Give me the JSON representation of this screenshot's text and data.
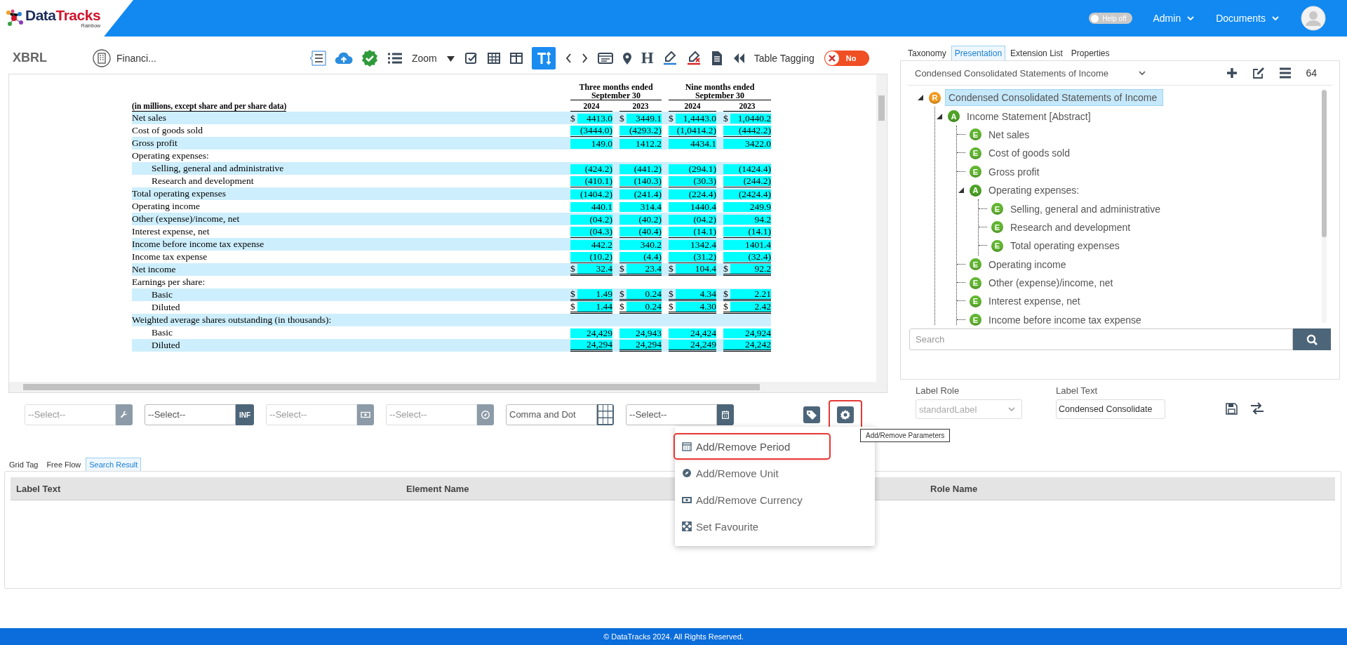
{
  "header": {
    "logo_primary": "Data",
    "logo_secondary": "Tracks",
    "logo_subtitle": "Rainbow",
    "help_toggle": {
      "label": "Help off",
      "on": false
    },
    "menus": [
      "Admin",
      "Documents"
    ]
  },
  "toolbar": {
    "title": "XBRL",
    "document": "Financi...",
    "tools": [
      {
        "kind": "icon",
        "selected": false
      },
      {
        "kind": "icon",
        "selected": false
      },
      {
        "kind": "icon",
        "selected": false
      },
      {
        "kind": "icon",
        "selected": false
      },
      {
        "kind": "label",
        "text": "Zoom"
      },
      {
        "kind": "icon",
        "selected": false
      },
      {
        "kind": "icon",
        "selected": false
      },
      {
        "kind": "icon",
        "selected": false
      },
      {
        "kind": "icon",
        "selected": false
      },
      {
        "kind": "icon",
        "selected": true
      },
      {
        "kind": "icon",
        "selected": false
      },
      {
        "kind": "icon",
        "selected": false
      },
      {
        "kind": "icon",
        "selected": false
      },
      {
        "kind": "icon",
        "selected": false
      },
      {
        "kind": "glyph",
        "text": "H"
      },
      {
        "kind": "icon",
        "selected": false
      },
      {
        "kind": "icon",
        "selected": false
      },
      {
        "kind": "icon",
        "selected": false
      },
      {
        "kind": "icon",
        "selected": false
      },
      {
        "kind": "label",
        "text": "Table Tagging"
      }
    ],
    "toggle": {
      "label": "No",
      "on": false
    }
  },
  "statement": {
    "caption": "(in millions, except share and per share data)",
    "groups": [
      "Three months ended September 30",
      "Nine months ended September 30"
    ],
    "years": [
      "2024",
      "2023",
      "2024",
      "2023"
    ],
    "rows": [
      {
        "label": "Net sales",
        "kind": "line",
        "shaded": true,
        "cells": [
          {
            "symbol": "$",
            "value": "4413.0"
          },
          {
            "symbol": "$",
            "value": "3449.1"
          },
          {
            "symbol": "$",
            "value": "1,4443.0"
          },
          {
            "symbol": "$",
            "value": "1,0440.2"
          }
        ]
      },
      {
        "label": "Cost of goods sold",
        "kind": "line",
        "shaded": false,
        "underlined": true,
        "cells": [
          {
            "value": "(3444.0)"
          },
          {
            "value": "(4293.2)"
          },
          {
            "value": "(1,0414.2)"
          },
          {
            "value": "(4442.2)"
          }
        ]
      },
      {
        "label": "Gross profit",
        "kind": "line",
        "shaded": true,
        "cells": [
          {
            "value": "149.0"
          },
          {
            "value": "1412.2"
          },
          {
            "value": "4434.1"
          },
          {
            "value": "3422.0"
          }
        ]
      },
      {
        "label": "Operating expenses:",
        "kind": "line",
        "shaded": false
      },
      {
        "label": "Selling, general and administrative",
        "kind": "sub",
        "shaded": true,
        "cells": [
          {
            "value": "(424.2)"
          },
          {
            "value": "(441.2)"
          },
          {
            "value": "(294.1)"
          },
          {
            "value": "(1424.4)"
          }
        ]
      },
      {
        "label": "Research and development",
        "kind": "sub",
        "shaded": false,
        "underlined": true,
        "cells": [
          {
            "value": "(410.1)"
          },
          {
            "value": "(140.3)"
          },
          {
            "value": "(30.3)"
          },
          {
            "value": "(244.2)"
          }
        ]
      },
      {
        "label": "Total operating expenses",
        "kind": "line",
        "shaded": true,
        "cells": [
          {
            "value": "(1404.2)"
          },
          {
            "value": "(241.4)"
          },
          {
            "value": "(224.4)"
          },
          {
            "value": "(2424.4)"
          }
        ]
      },
      {
        "label": "Operating income",
        "kind": "line",
        "shaded": false,
        "cells": [
          {
            "value": "440.1"
          },
          {
            "value": "314.4"
          },
          {
            "value": "1440.4"
          },
          {
            "value": "249.9"
          }
        ]
      },
      {
        "label": "Other (expense)/income, net",
        "kind": "line",
        "shaded": true,
        "cells": [
          {
            "value": "(04.2)"
          },
          {
            "value": "(40.2)"
          },
          {
            "value": "(04.2)"
          },
          {
            "value": "94.2"
          }
        ]
      },
      {
        "label": "Interest expense, net",
        "kind": "line",
        "shaded": false,
        "underlined": true,
        "cells": [
          {
            "value": "(04.3)"
          },
          {
            "value": "(40.4)"
          },
          {
            "value": "(14.1)"
          },
          {
            "value": "(14.1)"
          }
        ]
      },
      {
        "label": "Income before income tax expense",
        "kind": "line",
        "shaded": true,
        "cells": [
          {
            "value": "442.2"
          },
          {
            "value": "340.2"
          },
          {
            "value": "1342.4"
          },
          {
            "value": "1401.4"
          }
        ]
      },
      {
        "label": "Income tax expense",
        "kind": "line",
        "shaded": false,
        "underlined": true,
        "cells": [
          {
            "value": "(10.2)"
          },
          {
            "value": "(4.4)"
          },
          {
            "value": "(31.2)"
          },
          {
            "value": "(32.4)"
          }
        ]
      },
      {
        "label": "Net income",
        "kind": "line",
        "shaded": true,
        "double_underlined": true,
        "cells": [
          {
            "symbol": "$",
            "value": "32.4"
          },
          {
            "symbol": "$",
            "value": "23.4"
          },
          {
            "symbol": "$",
            "value": "104.4"
          },
          {
            "symbol": "$",
            "value": "92.2"
          }
        ]
      },
      {
        "label": "Earnings per share:",
        "kind": "line",
        "shaded": false
      },
      {
        "label": "Basic",
        "kind": "sub",
        "shaded": true,
        "double_underlined": true,
        "cells": [
          {
            "symbol": "$",
            "value": "1.49"
          },
          {
            "symbol": "$",
            "value": "0.24"
          },
          {
            "symbol": "$",
            "value": "4.34"
          },
          {
            "symbol": "$",
            "value": "2.21"
          }
        ]
      },
      {
        "label": "Diluted",
        "kind": "sub",
        "shaded": false,
        "double_underlined": true,
        "cells": [
          {
            "symbol": "$",
            "value": "1.44"
          },
          {
            "symbol": "$",
            "value": "0.24"
          },
          {
            "symbol": "$",
            "value": "4.30"
          },
          {
            "symbol": "$",
            "value": "2.42"
          }
        ]
      },
      {
        "label": "Weighted average shares outstanding (in thousands):",
        "kind": "line",
        "shaded": true
      },
      {
        "label": "Basic",
        "kind": "sub",
        "shaded": false,
        "cells": [
          {
            "value": "24,429"
          },
          {
            "value": "24,943"
          },
          {
            "value": "24,424"
          },
          {
            "value": "24,924"
          }
        ]
      },
      {
        "label": "Diluted",
        "kind": "sub",
        "shaded": true,
        "double_underlined": true,
        "cells": [
          {
            "value": "24,294"
          },
          {
            "value": "24,294"
          },
          {
            "value": "24,249"
          },
          {
            "value": "24,242"
          }
        ]
      }
    ]
  },
  "fields": [
    {
      "value": "--Select--",
      "disabled": true,
      "button": {
        "kind": "icon"
      }
    },
    {
      "value": "--Select--",
      "disabled": false,
      "button": {
        "kind": "text",
        "label": "INF"
      }
    },
    {
      "value": "--Select--",
      "disabled": true,
      "button": {
        "kind": "icon"
      }
    },
    {
      "value": "--Select--",
      "disabled": true,
      "button": {
        "kind": "icon"
      }
    },
    {
      "value": "Comma and Dot",
      "disabled": false,
      "button": {
        "kind": "grid"
      }
    },
    {
      "value": "--Select--",
      "disabled": false,
      "button": {
        "kind": "icon"
      }
    }
  ],
  "action_buttons": [
    {
      "highlighted": false
    },
    {
      "highlighted": true
    }
  ],
  "tooltip": "Add/Remove Parameters",
  "parameters_menu": [
    {
      "label": "Add/Remove Period",
      "highlighted": true
    },
    {
      "label": "Add/Remove Unit",
      "highlighted": false
    },
    {
      "label": "Add/Remove Currency",
      "highlighted": false
    },
    {
      "label": "Set Favourite",
      "highlighted": false
    }
  ],
  "side_panel": {
    "tabs": [
      {
        "label": "Taxonomy",
        "selected": false
      },
      {
        "label": "Presentation",
        "selected": true
      },
      {
        "label": "Extension List",
        "selected": false
      },
      {
        "label": "Properties",
        "selected": false
      }
    ],
    "statement_select": "Condensed Consolidated Statements of Income",
    "count": "64",
    "tree": [
      {
        "kind": "role",
        "badge": "R",
        "label": "Condensed Consolidated Statements of Income",
        "selected": true,
        "expanded": true,
        "children": [
          {
            "kind": "abstract",
            "badge": "A",
            "label": "Income Statement [Abstract]",
            "selected": false,
            "expanded": true,
            "children": [
              {
                "kind": "element",
                "badge": "E",
                "label": "Net sales",
                "selected": false
              },
              {
                "kind": "element",
                "badge": "E",
                "label": "Cost of goods sold",
                "selected": false
              },
              {
                "kind": "element",
                "badge": "E",
                "label": "Gross profit",
                "selected": false
              },
              {
                "kind": "abstract",
                "badge": "A",
                "label": "Operating expenses:",
                "selected": false,
                "expanded": true,
                "children": [
                  {
                    "kind": "element",
                    "badge": "E",
                    "label": "Selling, general and administrative",
                    "selected": false
                  },
                  {
                    "kind": "element",
                    "badge": "E",
                    "label": "Research and development",
                    "selected": false
                  },
                  {
                    "kind": "element",
                    "badge": "E",
                    "label": "Total operating expenses",
                    "selected": false
                  }
                ]
              },
              {
                "kind": "element",
                "badge": "E",
                "label": "Operating income",
                "selected": false
              },
              {
                "kind": "element",
                "badge": "E",
                "label": "Other (expense)/income, net",
                "selected": false
              },
              {
                "kind": "element",
                "badge": "E",
                "label": "Interest expense, net",
                "selected": false
              },
              {
                "kind": "element",
                "badge": "E",
                "label": "Income before income tax expense",
                "selected": false
              }
            ]
          }
        ]
      }
    ],
    "search": {
      "placeholder": "Search"
    }
  },
  "label_role": {
    "label": "Label Role",
    "value": "standardLabel",
    "disabled": true
  },
  "label_text": {
    "label": "Label Text",
    "value": "Condensed Consolidate"
  },
  "bottom_tabs": [
    {
      "label": "Grid Tag",
      "selected": false
    },
    {
      "label": "Free Flow",
      "selected": false
    },
    {
      "label": "Search Result",
      "selected": true
    }
  ],
  "results": {
    "columns": [
      "Label Text",
      "Element Name",
      "Role Name"
    ]
  },
  "footer": "© DataTracks 2024. All Rights Reserved."
}
